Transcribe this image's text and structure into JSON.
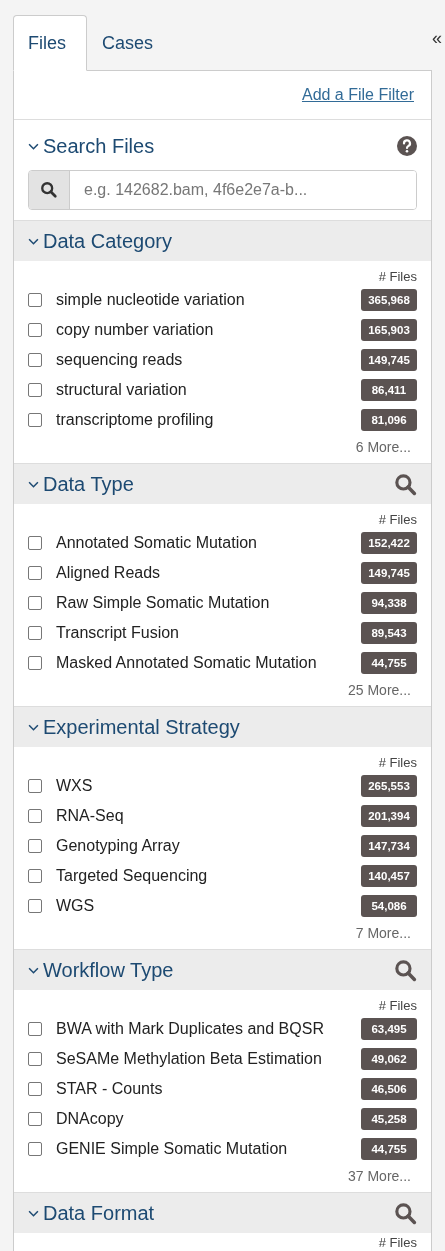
{
  "tabs": [
    {
      "label": "Files",
      "selected": true
    },
    {
      "label": "Cases",
      "selected": false
    }
  ],
  "collapse_icon": "«",
  "add_filter_link": "Add a File Filter",
  "search_files": {
    "title": "Search Files",
    "placeholder": "e.g. 142682.bam, 4f6e2e7a-b..."
  },
  "facets": [
    {
      "title": "Data Category",
      "has_search": false,
      "count_header": "# Files",
      "more": "6 More...",
      "items": [
        {
          "label": "simple nucleotide variation",
          "count": "365,968",
          "checked": false
        },
        {
          "label": "copy number variation",
          "count": "165,903",
          "checked": false
        },
        {
          "label": "sequencing reads",
          "count": "149,745",
          "checked": false
        },
        {
          "label": "structural variation",
          "count": "86,411",
          "checked": false
        },
        {
          "label": "transcriptome profiling",
          "count": "81,096",
          "checked": false
        }
      ]
    },
    {
      "title": "Data Type",
      "has_search": true,
      "count_header": "# Files",
      "more": "25 More...",
      "items": [
        {
          "label": "Annotated Somatic Mutation",
          "count": "152,422",
          "checked": false
        },
        {
          "label": "Aligned Reads",
          "count": "149,745",
          "checked": false
        },
        {
          "label": "Raw Simple Somatic Mutation",
          "count": "94,338",
          "checked": false
        },
        {
          "label": "Transcript Fusion",
          "count": "89,543",
          "checked": false
        },
        {
          "label": "Masked Annotated Somatic Mutation",
          "count": "44,755",
          "checked": false
        }
      ]
    },
    {
      "title": "Experimental Strategy",
      "has_search": false,
      "count_header": "# Files",
      "more": "7 More...",
      "items": [
        {
          "label": "WXS",
          "count": "265,553",
          "checked": false
        },
        {
          "label": "RNA-Seq",
          "count": "201,394",
          "checked": false
        },
        {
          "label": "Genotyping Array",
          "count": "147,734",
          "checked": false
        },
        {
          "label": "Targeted Sequencing",
          "count": "140,457",
          "checked": false
        },
        {
          "label": "WGS",
          "count": "54,086",
          "checked": false
        }
      ]
    },
    {
      "title": "Workflow Type",
      "has_search": true,
      "count_header": "# Files",
      "more": "37 More...",
      "items": [
        {
          "label": "BWA with Mark Duplicates and BQSR",
          "count": "63,495",
          "checked": false
        },
        {
          "label": "SeSAMe Methylation Beta Estimation",
          "count": "49,062",
          "checked": false
        },
        {
          "label": "STAR - Counts",
          "count": "46,506",
          "checked": false
        },
        {
          "label": "DNAcopy",
          "count": "45,258",
          "checked": false
        },
        {
          "label": "GENIE Simple Somatic Mutation",
          "count": "44,755",
          "checked": false
        }
      ]
    },
    {
      "title": "Data Format",
      "has_search": true,
      "count_header": "# Files"
    }
  ]
}
